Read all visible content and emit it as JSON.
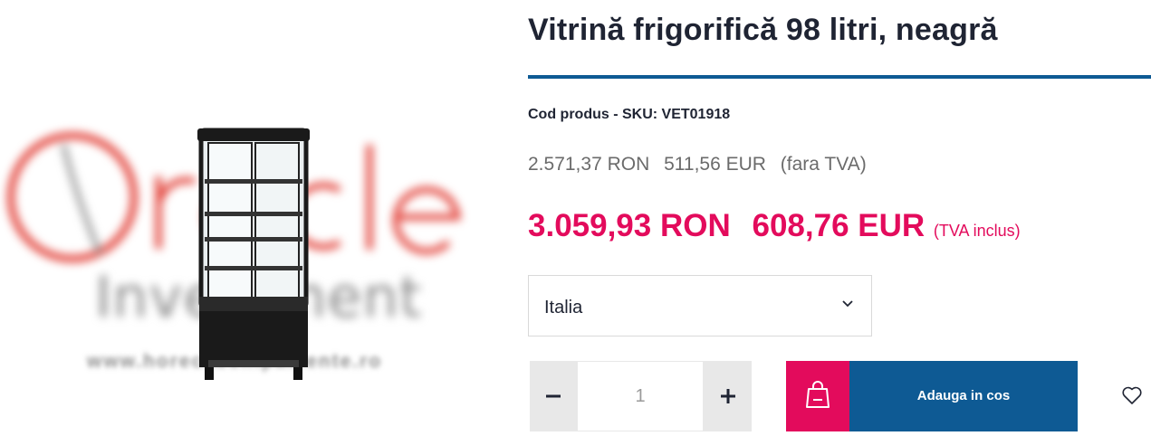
{
  "product": {
    "title": "Vitrină frigorifică 98 litri, neagră",
    "sku": "Cod produs - SKU: VET01918"
  },
  "gallery": {
    "image_icon": "refrigerated-display-case-image",
    "watermark_text": "Oracle Investment",
    "watermark_url": "www.horecaechipamente.ro"
  },
  "pricing": {
    "net_ron": "2.571,37 RON",
    "net_eur": "511,56 EUR",
    "net_note": "(fara TVA)",
    "gross_ron": "3.059,93 RON",
    "gross_eur": "608,76 EUR",
    "gross_note": "(TVA inclus)"
  },
  "variant_select": {
    "value": "Italia",
    "icon": "chevron-down-icon"
  },
  "quantity": {
    "value": "1",
    "minus_icon": "minus-icon",
    "plus_icon": "plus-icon"
  },
  "cart": {
    "label": "Adauga in cos",
    "icon": "shopping-bag-icon"
  },
  "wishlist": {
    "icon": "heart-icon"
  },
  "colors": {
    "accent_pink": "#e30b5c",
    "brand_blue": "#0e5a94",
    "title_text": "#1f2433"
  }
}
